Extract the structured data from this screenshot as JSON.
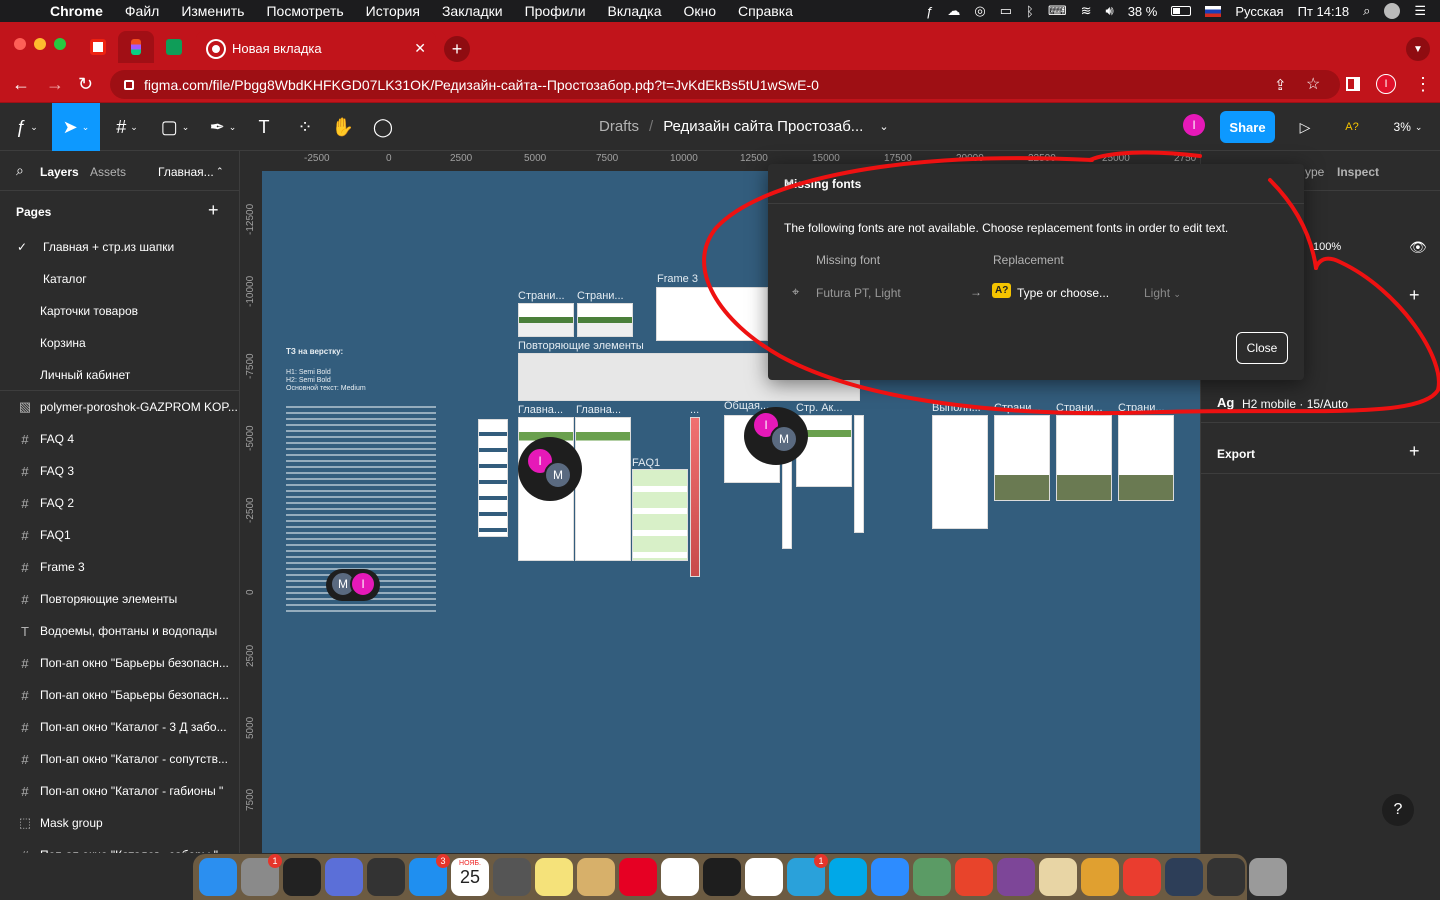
{
  "menubar": {
    "app": "Chrome",
    "items": [
      "Файл",
      "Изменить",
      "Посмотреть",
      "История",
      "Закладки",
      "Профили",
      "Вкладка",
      "Окно",
      "Справка"
    ],
    "battery": "38 %",
    "input_lang": "Русская",
    "clock": "Пт 14:18"
  },
  "browser": {
    "tab_title": "Новая вкладка",
    "url": "figma.com/file/Pbgg8WbdKHFKGD07LK31OK/Редизайн-сайта--Простозабор.рф?t=JvKdEkBs5tU1wSwE-0",
    "profile_initial": "I"
  },
  "figma": {
    "breadcrumb_root": "Drafts",
    "file_name": "Редизайн сайта Простозаб...",
    "user_initial": "I",
    "share_label": "Share",
    "missing_font_badge": "A?",
    "zoom": "3%"
  },
  "left_panel": {
    "tab_layers": "Layers",
    "tab_assets": "Assets",
    "current_page_short": "Главная...",
    "pages_header": "Pages",
    "pages": [
      {
        "label": "Главная + стр.из шапки",
        "selected": true
      },
      {
        "label": "Каталог",
        "selected": false
      },
      {
        "label": "Карточки товаров",
        "selected": false
      },
      {
        "label": "Корзина",
        "selected": false
      },
      {
        "label": "Личный кабинет",
        "selected": false
      }
    ],
    "layers": [
      {
        "icon": "image-icon",
        "glyph": "▧",
        "label": "polymer-poroshok-GAZPROM KOP..."
      },
      {
        "icon": "frame-icon",
        "glyph": "#",
        "label": "FAQ 4"
      },
      {
        "icon": "frame-icon",
        "glyph": "#",
        "label": "FAQ 3"
      },
      {
        "icon": "frame-icon",
        "glyph": "#",
        "label": "FAQ 2"
      },
      {
        "icon": "frame-icon",
        "glyph": "#",
        "label": "FAQ1"
      },
      {
        "icon": "frame-icon",
        "glyph": "#",
        "label": "Frame 3"
      },
      {
        "icon": "frame-icon",
        "glyph": "#",
        "label": "Повторяющие элементы"
      },
      {
        "icon": "text-icon",
        "glyph": "T",
        "label": "Водоемы, фонтаны и водопады"
      },
      {
        "icon": "frame-icon",
        "glyph": "#",
        "label": "Поп-ап окно \"Барьеры безопасн..."
      },
      {
        "icon": "frame-icon",
        "glyph": "#",
        "label": "Поп-ап окно \"Барьеры безопасн..."
      },
      {
        "icon": "frame-icon",
        "glyph": "#",
        "label": "Поп-ап окно \"Каталог - 3 Д забо..."
      },
      {
        "icon": "frame-icon",
        "glyph": "#",
        "label": "Поп-ап окно \"Каталог - сопутств..."
      },
      {
        "icon": "frame-icon",
        "glyph": "#",
        "label": "Поп-ап окно \"Каталог - габионы \""
      },
      {
        "icon": "mask-icon",
        "glyph": "⬚",
        "label": "Mask group"
      },
      {
        "icon": "frame-icon",
        "glyph": "#",
        "label": "Поп-ап окно \"Каталог - заборы \""
      }
    ]
  },
  "rulers": {
    "top": [
      "-2500",
      "0",
      "2500",
      "5000",
      "7500",
      "10000",
      "12500",
      "15000",
      "17500",
      "20000",
      "22500",
      "25000",
      "2750"
    ],
    "left": [
      "-12500",
      "-10000",
      "-7500",
      "-5000",
      "-2500",
      "0",
      "2500",
      "5000",
      "7500"
    ]
  },
  "canvas": {
    "frame_labels": {
      "str1": "Страни...",
      "str2": "Страни...",
      "frame3": "Frame 3",
      "repeat": "Повторяющие элементы",
      "main1": "Главна...",
      "main2": "Главна...",
      "dots1": "...",
      "faq1": "FAQ1",
      "general": "Общая...",
      "strak": "Стр. Ак...",
      "vypol": "Выполн...",
      "str3": "Страни...",
      "str4": "Страни...",
      "str5": "Страни..."
    },
    "tz_title": "ТЗ на верстку:",
    "tz_fonts": [
      "H1: Semi Bold",
      "H2: Semi Bold",
      "Основной текст: Medium"
    ],
    "collaborators": [
      "I",
      "M"
    ]
  },
  "right_panel": {
    "tab_type": "ype",
    "tab_inspect": "Inspect",
    "opacity": "100%",
    "text_style_badge": "Ag",
    "text_style": "H2 mobile · 15/Auto",
    "export_label": "Export"
  },
  "modal": {
    "title": "Missing fonts",
    "message": "The following fonts are not available. Choose replacement fonts in order to edit text.",
    "col_missing": "Missing font",
    "col_replacement": "Replacement",
    "missing_font": "Futura PT, Light",
    "replacement_badge": "A?",
    "replacement_placeholder": "Type or choose...",
    "weight": "Light",
    "close_label": "Close"
  },
  "dock": {
    "apps": [
      {
        "name": "finder",
        "color": "#2b8ff0",
        "badge": ""
      },
      {
        "name": "system-preferences",
        "color": "#8a8a8a",
        "badge": "1"
      },
      {
        "name": "obs",
        "color": "#222222",
        "badge": ""
      },
      {
        "name": "screenshot",
        "color": "#5b6fd8",
        "badge": ""
      },
      {
        "name": "photo-booth",
        "color": "#333333",
        "badge": ""
      },
      {
        "name": "app-store",
        "color": "#1f8ff0",
        "badge": "3"
      },
      {
        "name": "calendar",
        "color": "#ffffff",
        "badge": ""
      },
      {
        "name": "calculator",
        "color": "#555555",
        "badge": ""
      },
      {
        "name": "notes",
        "color": "#f5e27a",
        "badge": ""
      },
      {
        "name": "preview",
        "color": "#d7b06a",
        "badge": ""
      },
      {
        "name": "pinterest",
        "color": "#e60023",
        "badge": ""
      },
      {
        "name": "yandex",
        "color": "#ffffff",
        "badge": ""
      },
      {
        "name": "figma",
        "color": "#1e1e1e",
        "badge": ""
      },
      {
        "name": "chrome",
        "color": "#ffffff",
        "badge": ""
      },
      {
        "name": "telegram",
        "color": "#2aa1da",
        "badge": "1"
      },
      {
        "name": "skype",
        "color": "#00a8e8",
        "badge": ""
      },
      {
        "name": "zoom",
        "color": "#2d8cff",
        "badge": ""
      },
      {
        "name": "chromium",
        "color": "#5b9b65",
        "badge": ""
      },
      {
        "name": "anydesk",
        "color": "#e8442b",
        "badge": ""
      },
      {
        "name": "tor",
        "color": "#7d4698",
        "badge": ""
      },
      {
        "name": "folder",
        "color": "#e8d5a5",
        "badge": ""
      },
      {
        "name": "cat-app",
        "color": "#e0a030",
        "badge": ""
      },
      {
        "name": "creative-cloud",
        "color": "#ea3d2f",
        "badge": ""
      },
      {
        "name": "screen-recorder",
        "color": "#2d3e58",
        "badge": ""
      },
      {
        "name": "activity-monitor",
        "color": "#333333",
        "badge": ""
      },
      {
        "name": "trash",
        "color": "#9a9a9a",
        "badge": ""
      }
    ],
    "calendar_day": "25",
    "calendar_month": "НОЯБ."
  }
}
